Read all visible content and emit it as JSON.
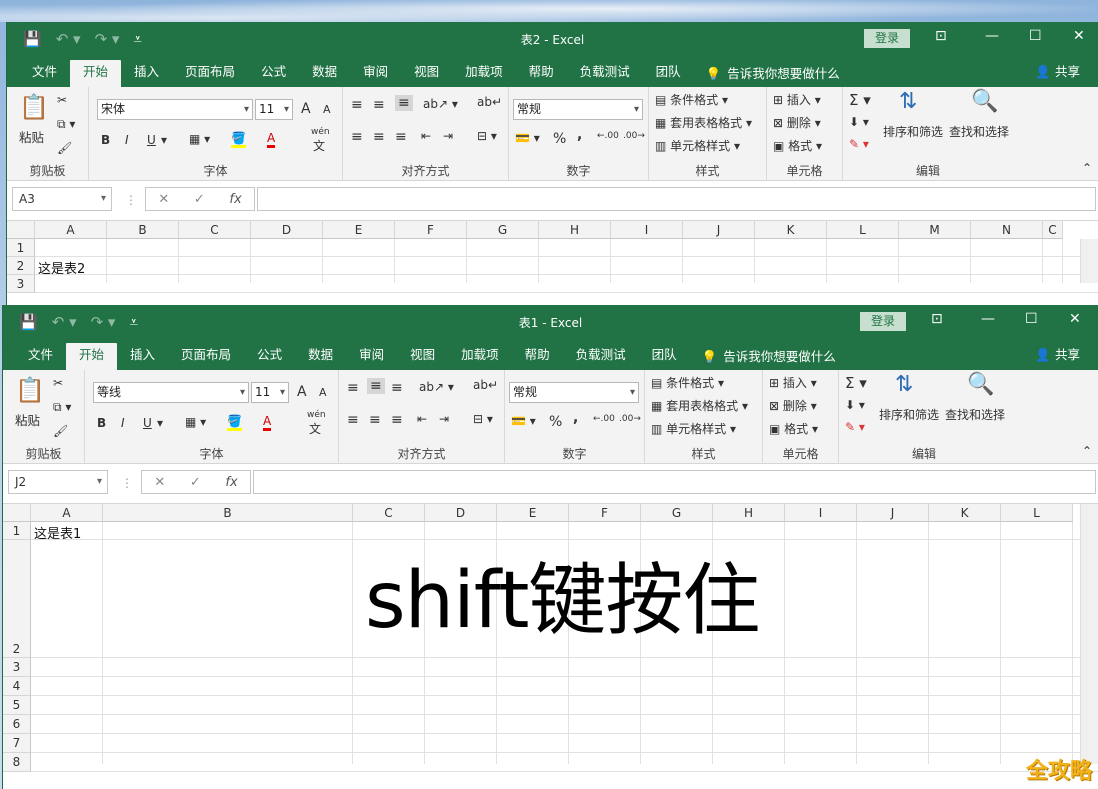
{
  "brand": {
    "accent": "#217346",
    "login_bg": "#c6dfce"
  },
  "ribbon": {
    "tabs": [
      "文件",
      "开始",
      "插入",
      "页面布局",
      "公式",
      "数据",
      "审阅",
      "视图",
      "加载项",
      "帮助",
      "负载测试",
      "团队"
    ],
    "tell_me": "告诉我你想要做什么",
    "share": "共享",
    "login": "登录",
    "clipboard": {
      "paste": "粘贴",
      "label": "剪贴板"
    },
    "font": {
      "label": "字体",
      "size": "11",
      "bold": "B",
      "italic": "I",
      "underline": "U",
      "grow": "A",
      "shrink": "A",
      "wen": "wén",
      "wen_char": "文"
    },
    "alignment": {
      "label": "对齐方式"
    },
    "number": {
      "label": "数字",
      "format": "常规",
      "percent": "%",
      "comma": ","
    },
    "styles": {
      "label": "样式",
      "conditional": "条件格式",
      "table": "套用表格格式",
      "cell": "单元格样式"
    },
    "cells": {
      "label": "单元格",
      "insert": "插入",
      "delete": "删除",
      "format": "格式"
    },
    "editing": {
      "label": "编辑",
      "sort": "排序和筛选",
      "find": "查找和选择"
    }
  },
  "window2": {
    "title": "表2  -  Excel",
    "font_name": "宋体",
    "name_box": "A3",
    "columns": [
      "A",
      "B",
      "C",
      "D",
      "E",
      "F",
      "G",
      "H",
      "I",
      "J",
      "K",
      "L",
      "M",
      "N",
      "C"
    ],
    "rows": [
      "1",
      "2",
      "3"
    ],
    "cells": {
      "A2": "这是表2"
    }
  },
  "window1": {
    "title": "表1  -  Excel",
    "font_name": "等线",
    "name_box": "J2",
    "columns": [
      "A",
      "B",
      "C",
      "D",
      "E",
      "F",
      "G",
      "H",
      "I",
      "J",
      "K",
      "L"
    ],
    "rows": [
      "1",
      "2",
      "3",
      "4",
      "5",
      "6",
      "7",
      "8"
    ],
    "cells": {
      "A1": "这是表1",
      "C2": "shift键按住"
    }
  },
  "formula_buttons": {
    "cancel": "✕",
    "enter": "✓",
    "fx": "fx"
  },
  "watermark": "全攻略"
}
